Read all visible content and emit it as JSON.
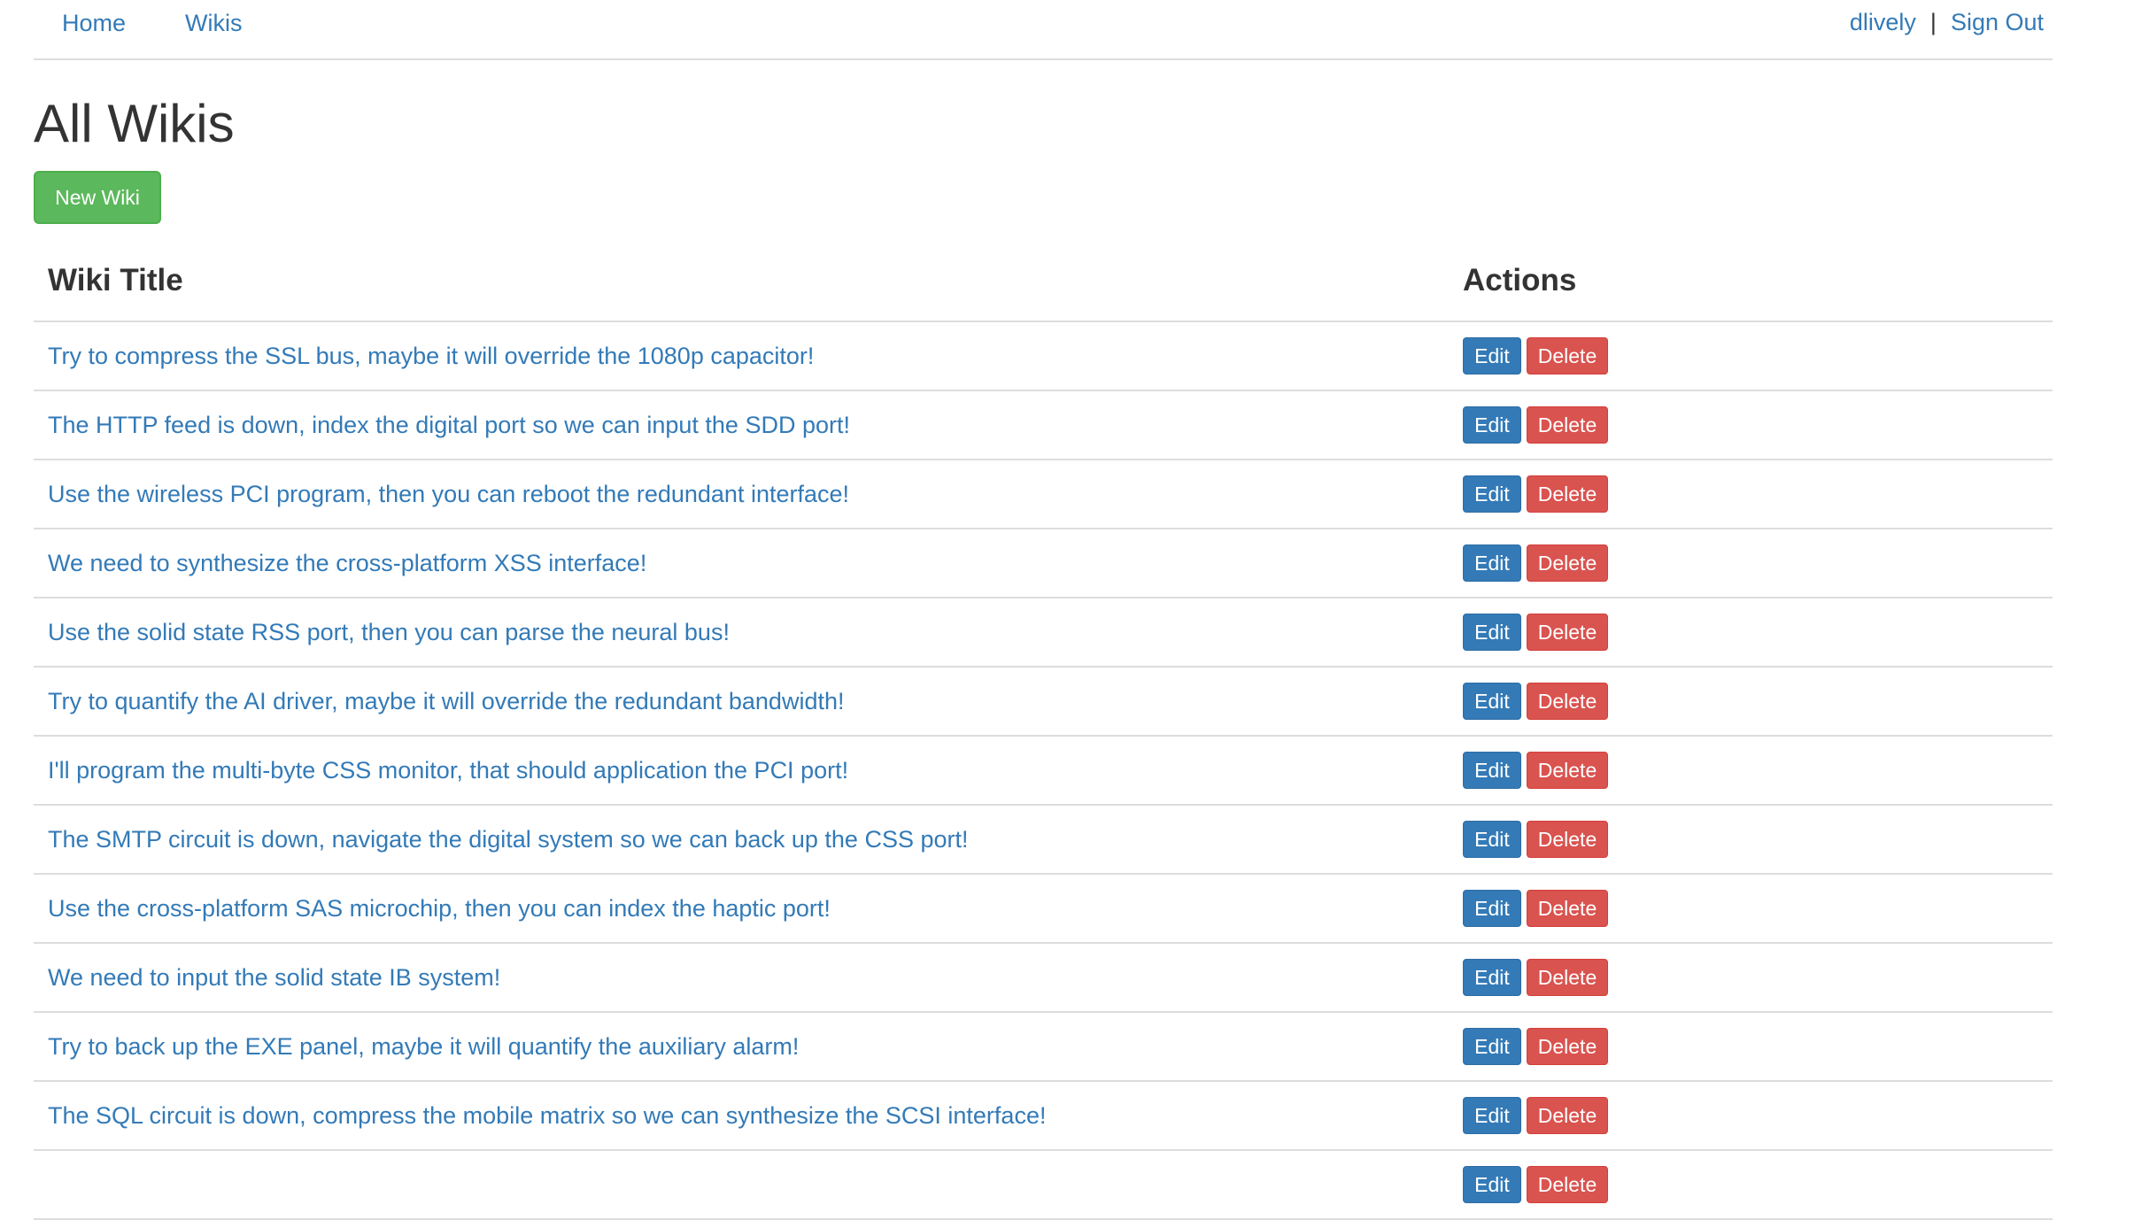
{
  "nav": {
    "home_label": "Home",
    "wikis_label": "Wikis",
    "username": "dlively",
    "separator": "|",
    "sign_out_label": "Sign Out"
  },
  "page": {
    "title": "All Wikis",
    "new_wiki_label": "New Wiki"
  },
  "table": {
    "headers": {
      "title": "Wiki Title",
      "actions": "Actions"
    },
    "edit_label": "Edit",
    "delete_label": "Delete",
    "rows": [
      "Try to compress the SSL bus, maybe it will override the 1080p capacitor!",
      "The HTTP feed is down, index the digital port so we can input the SDD port!",
      "Use the wireless PCI program, then you can reboot the redundant interface!",
      "We need to synthesize the cross-platform XSS interface!",
      "Use the solid state RSS port, then you can parse the neural bus!",
      "Try to quantify the AI driver, maybe it will override the redundant bandwidth!",
      "I'll program the multi-byte CSS monitor, that should application the PCI port!",
      "The SMTP circuit is down, navigate the digital system so we can back up the CSS port!",
      "Use the cross-platform SAS microchip, then you can index the haptic port!",
      "We need to input the solid state IB system!",
      "Try to back up the EXE panel, maybe it will quantify the auxiliary alarm!",
      "The SQL circuit is down, compress the mobile matrix so we can synthesize the SCSI interface!",
      ""
    ]
  },
  "colors": {
    "link": "#337ab7",
    "success": "#5cb85c",
    "primary": "#337ab7",
    "danger": "#d9534f",
    "text": "#333333",
    "border": "#dddddd"
  }
}
